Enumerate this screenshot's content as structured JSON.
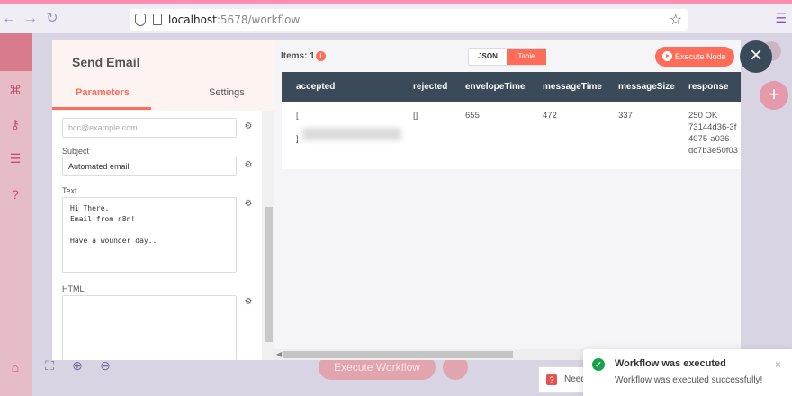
{
  "browser": {
    "url_host": "localhost",
    "url_path": ":5678/workflow"
  },
  "node": {
    "title": "Send Email",
    "tabs": {
      "parameters": "Parameters",
      "settings": "Settings"
    }
  },
  "params": {
    "bcc_placeholder": "bcc@example.com",
    "subject_label": "Subject",
    "subject_value": "Automated email",
    "text_label": "Text",
    "text_value": "Hi There,\nEmail from n8n!\n\nHave a wounder day..",
    "html_label": "HTML"
  },
  "output": {
    "items_label": "Items: 1",
    "items_badge": "i",
    "json_label": "JSON",
    "table_label": "Table",
    "execute_label": "Execute Node",
    "columns": [
      "accepted",
      "rejected",
      "envelopeTime",
      "messageTime",
      "messageSize",
      "response"
    ],
    "row": {
      "accepted_open": "[",
      "accepted_close": "]",
      "rejected": "[]",
      "envelopeTime": "655",
      "messageTime": "472",
      "messageSize": "337",
      "response": "250 OK\n73144d36-3f\n4075-a036-\ndc7b3e50f03"
    }
  },
  "canvas": {
    "execute_workflow": "Execute Workflow",
    "need_tip": "Need"
  },
  "toast": {
    "title": "Workflow was executed",
    "message": "Workflow was executed successfully!"
  },
  "colors": {
    "accent": "#ff6d5a",
    "header": "#3b4a59",
    "success": "#17a34a"
  }
}
